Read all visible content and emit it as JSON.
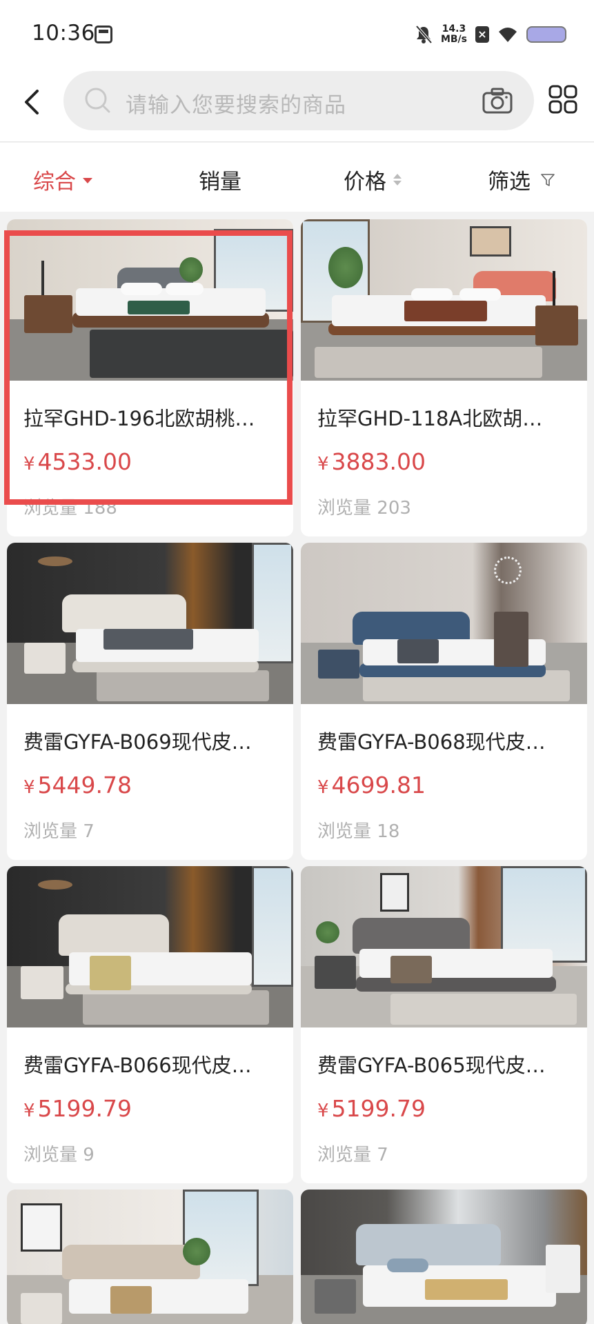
{
  "status_bar": {
    "time": "10:36",
    "net_speed_value": "14.3",
    "net_speed_unit": "MB/s"
  },
  "search": {
    "placeholder": "请输入您要搜索的商品"
  },
  "sort_bar": {
    "items": [
      "综合",
      "销量",
      "价格",
      "筛选"
    ],
    "active": "综合"
  },
  "products": [
    {
      "title": "拉罕GHD-196北欧胡桃…",
      "price": "4533.00",
      "currency": "¥",
      "views_label": "浏览量",
      "views": "188"
    },
    {
      "title": "拉罕GHD-118A北欧胡…",
      "price": "3883.00",
      "currency": "¥",
      "views_label": "浏览量",
      "views": "203"
    },
    {
      "title": "费雷GYFA-B069现代皮…",
      "price": "5449.78",
      "currency": "¥",
      "views_label": "浏览量",
      "views": "7"
    },
    {
      "title": "费雷GYFA-B068现代皮…",
      "price": "4699.81",
      "currency": "¥",
      "views_label": "浏览量",
      "views": "18"
    },
    {
      "title": "费雷GYFA-B066现代皮…",
      "price": "5199.79",
      "currency": "¥",
      "views_label": "浏览量",
      "views": "9"
    },
    {
      "title": "费雷GYFA-B065现代皮…",
      "price": "5199.79",
      "currency": "¥",
      "views_label": "浏览量",
      "views": "7"
    }
  ],
  "colors": {
    "accent": "#d9484a",
    "highlight_box": "#ea4c4c",
    "background": "#f2f2f2",
    "muted_text": "#b0b0b0"
  }
}
